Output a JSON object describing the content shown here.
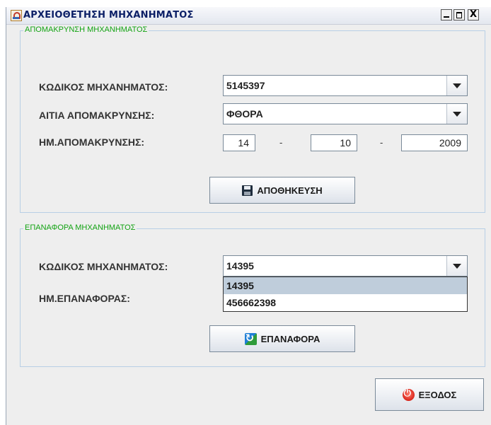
{
  "window": {
    "title": "ΑΡΧΕΙΟΘΕΤΗΣΗ ΜΗΧΑΝΗΜΑΤΟΣ",
    "close_glyph": "X"
  },
  "removal": {
    "legend": "ΑΠΟΜΑΚΡΥΝΣΗ ΜΗΧΑΝΗΜΑΤΟΣ",
    "code_label": "ΚΩΔΙΚΟΣ ΜΗΧΑΝΗΜΑΤΟΣ:",
    "code_value": "5145397",
    "reason_label": "ΑΙΤΙΑ ΑΠΟΜΑΚΡΥΝΣΗΣ:",
    "reason_value": "ΦΘΟΡΑ",
    "date_label": "ΗΜ.ΑΠΟΜΑΚΡΥΝΣΗΣ:",
    "date_day": "14",
    "date_month": "10",
    "date_year": "2009",
    "date_sep": "-",
    "save_label": "ΑΠΟΘΗΚΕΥΣΗ"
  },
  "restore": {
    "legend": "ΕΠΑΝΑΦΟΡΑ  ΜΗΧΑΝΗΜΑΤΟΣ",
    "code_label": "ΚΩΔΙΚΟΣ ΜΗΧΑΝΗΜΑΤΟΣ:",
    "code_value": "14395",
    "date_label": "ΗΜ.ΕΠΑΝΑΦΟΡΑΣ:",
    "dropdown_options": [
      "14395",
      "456662398"
    ],
    "restore_label": "ΕΠΑΝΑΦΟΡΑ"
  },
  "exit_label": "ΕΞΟΔΟΣ",
  "icons": {
    "app": "java-cup-icon",
    "save": "floppy-disk-icon",
    "restore": "restore-arrows-icon",
    "exit": "power-exit-icon"
  },
  "colors": {
    "legend": "#13a313",
    "title": "#0b1f66",
    "selected": "#bfcddb"
  }
}
